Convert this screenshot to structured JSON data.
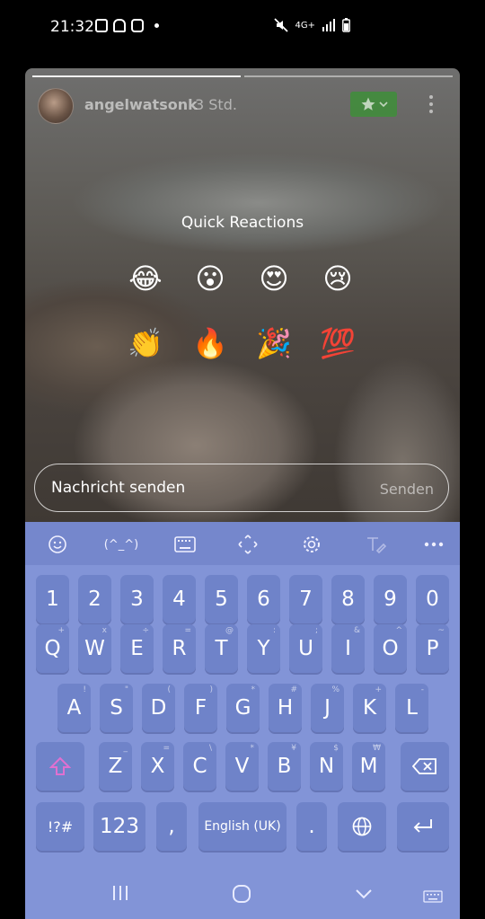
{
  "status_bar": {
    "time": "21:32",
    "network_label": "4G+",
    "icons": [
      "s-icon",
      "android-icon",
      "instagram-icon",
      "dot-icon",
      "mute-icon",
      "signal-icon",
      "battery-icon"
    ]
  },
  "story": {
    "username": "angelwatsonk",
    "time_ago": "3 Std.",
    "star_button_icon": "star-icon",
    "quick_reactions_title": "Quick Reactions",
    "reactions": [
      "😂",
      "😮",
      "😍",
      "😢",
      "👏",
      "🔥",
      "🎉",
      "💯"
    ],
    "message_placeholder": "Nachricht senden",
    "send_label": "Senden"
  },
  "keyboard": {
    "toolbar": [
      "emoji-icon",
      "(^_^)",
      "keyboard-icon",
      "move-cursor-icon",
      "settings-icon",
      "handwriting-icon",
      "more-icon"
    ],
    "row_numbers": [
      "1",
      "2",
      "3",
      "4",
      "5",
      "6",
      "7",
      "8",
      "9",
      "0"
    ],
    "row1": [
      {
        "k": "Q",
        "h": "+"
      },
      {
        "k": "W",
        "h": "x"
      },
      {
        "k": "E",
        "h": "÷"
      },
      {
        "k": "R",
        "h": "="
      },
      {
        "k": "T",
        "h": "@"
      },
      {
        "k": "Y",
        "h": ":"
      },
      {
        "k": "U",
        "h": ";"
      },
      {
        "k": "I",
        "h": "&"
      },
      {
        "k": "O",
        "h": "^"
      },
      {
        "k": "P",
        "h": "~"
      }
    ],
    "row2": [
      {
        "k": "A",
        "h": "!"
      },
      {
        "k": "S",
        "h": "\""
      },
      {
        "k": "D",
        "h": "("
      },
      {
        "k": "F",
        "h": ")"
      },
      {
        "k": "G",
        "h": "*"
      },
      {
        "k": "H",
        "h": "#"
      },
      {
        "k": "J",
        "h": "%"
      },
      {
        "k": "K",
        "h": "+"
      },
      {
        "k": "L",
        "h": "-"
      }
    ],
    "row3": [
      {
        "k": "Z",
        "h": "_"
      },
      {
        "k": "X",
        "h": "="
      },
      {
        "k": "C",
        "h": "\\"
      },
      {
        "k": "V",
        "h": "*"
      },
      {
        "k": "B",
        "h": "¥"
      },
      {
        "k": "N",
        "h": "$"
      },
      {
        "k": "M",
        "h": "₩"
      }
    ],
    "symbols_label": "!?#",
    "numbers_label": "123",
    "comma": ",",
    "space_label": "English (UK)",
    "period": "."
  },
  "colors": {
    "keyboard_bg": "#8294d7",
    "key_bg": "#6f83c9",
    "star_button": "#3f8f3a"
  }
}
